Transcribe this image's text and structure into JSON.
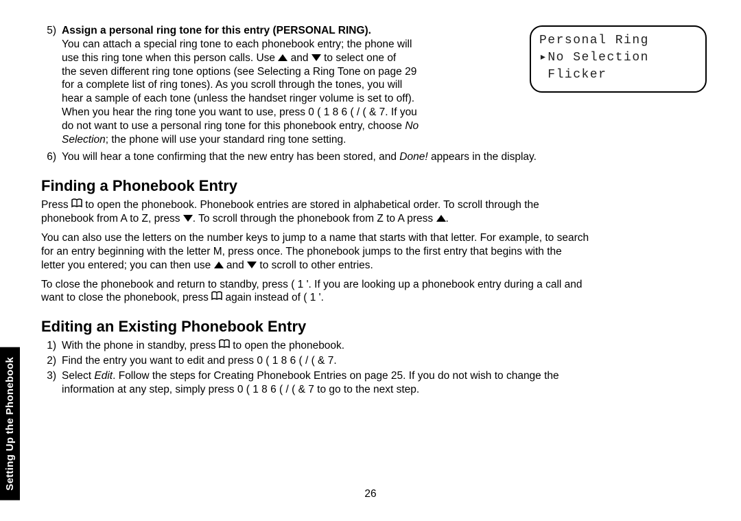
{
  "step5": {
    "num": "5)",
    "title": "Assign a personal ring tone for this entry (PERSONAL RING).",
    "line1a": "You can attach a special ring tone to each phonebook entry; the phone will",
    "line2a": "use this ring tone when this person calls. Use ",
    "line2b": " and ",
    "line2c": " to select one of",
    "line3": "the seven different ring tone options (see Selecting a Ring Tone on page 29",
    "line4": "for a complete list of ring tones). As you scroll through the tones, you will",
    "line5": "hear a sample of each tone (unless the handset ringer volume is set to off).",
    "line6": "When you hear the ring tone you want to use, press  0 ( 1 8   6 ( / ( & 7. If you",
    "line7a": "do not want to use a personal ring tone for this phonebook entry, choose ",
    "line7b": "No",
    "line8a": "Selection",
    "line8b": "; the phone will use your standard ring tone setting."
  },
  "lcd": {
    "line1": "Personal Ring",
    "line2": "▸No Selection",
    "line3": " Flicker"
  },
  "step6": {
    "num": "6)",
    "text_a": "You will hear a tone confirming that the new entry has been stored, and ",
    "text_b": "Done!",
    "text_c": " appears in the display."
  },
  "finding": {
    "heading": "Finding a Phonebook Entry",
    "p1a": "Press ",
    "p1b": " to open the phonebook. Phonebook entries are stored in alphabetical order. To scroll through the",
    "p1c": "phonebook from A to Z, press ",
    "p1d": ". To scroll through the phonebook from Z to A press ",
    "p1e": ".",
    "p2a": "You can also use the letters on the number keys to jump to a name that starts with that letter. For example, to search",
    "p2b": "for an entry beginning with the letter M, press    once. The phonebook jumps to the first entry that begins with the",
    "p2c": "letter you entered; you can then use ",
    "p2d": " and ",
    "p2e": " to scroll to other entries.",
    "p3a": "To close the phonebook and return to standby, press  ( 1 '. If you are looking up a phonebook entry during a call and",
    "p3b": "want to close the phonebook, press ",
    "p3c": " again instead of  ( 1 '."
  },
  "editing": {
    "heading": "Editing an Existing Phonebook Entry",
    "n1": "1)",
    "t1a": "With the phone in standby, press ",
    "t1b": " to open the phonebook.",
    "n2": "2)",
    "t2": "Find the entry you want to edit and press  0 ( 1 8   6 ( / ( & 7.",
    "n3": "3)",
    "t3a": "Select ",
    "t3b": "Edit",
    "t3c": ". Follow the steps for Creating Phonebook Entries on page 25. If you do not wish to change the",
    "t3d": "information at any step, simply press  0 ( 1 8   6 ( / ( & 7 to go to the next step."
  },
  "sidetab": "Setting Up the Phonebook",
  "pagenum": "26"
}
